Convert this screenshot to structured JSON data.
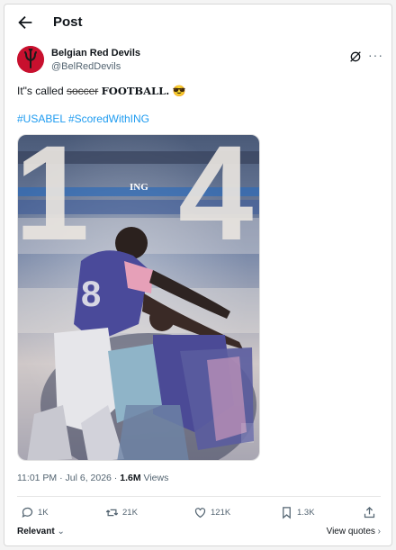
{
  "header": {
    "title": "Post"
  },
  "author": {
    "name": "Belgian Red Devils",
    "handle": "@BelRedDevils"
  },
  "tweet": {
    "prefix": "It\"s called ",
    "struck": "soccer",
    "emphasis": "FOOTBALL.",
    "emoji": "😎",
    "hashtags": [
      "#USABEL",
      "#ScoredWithING"
    ]
  },
  "media": {
    "score_home": "1",
    "score_away": "4",
    "sponsor": "ING",
    "player_number": "8"
  },
  "meta": {
    "time": "11:01 PM",
    "date": "Jul 6, 2026",
    "views_count": "1.6M",
    "views_label": "Views"
  },
  "actions": {
    "replies": "1K",
    "reposts": "21K",
    "likes": "121K",
    "bookmarks": "1.3K"
  },
  "footer": {
    "sort_label": "Relevant",
    "quotes_label": "View quotes"
  },
  "colors": {
    "accent": "#1d9bf0",
    "brand": "#c8102e"
  }
}
